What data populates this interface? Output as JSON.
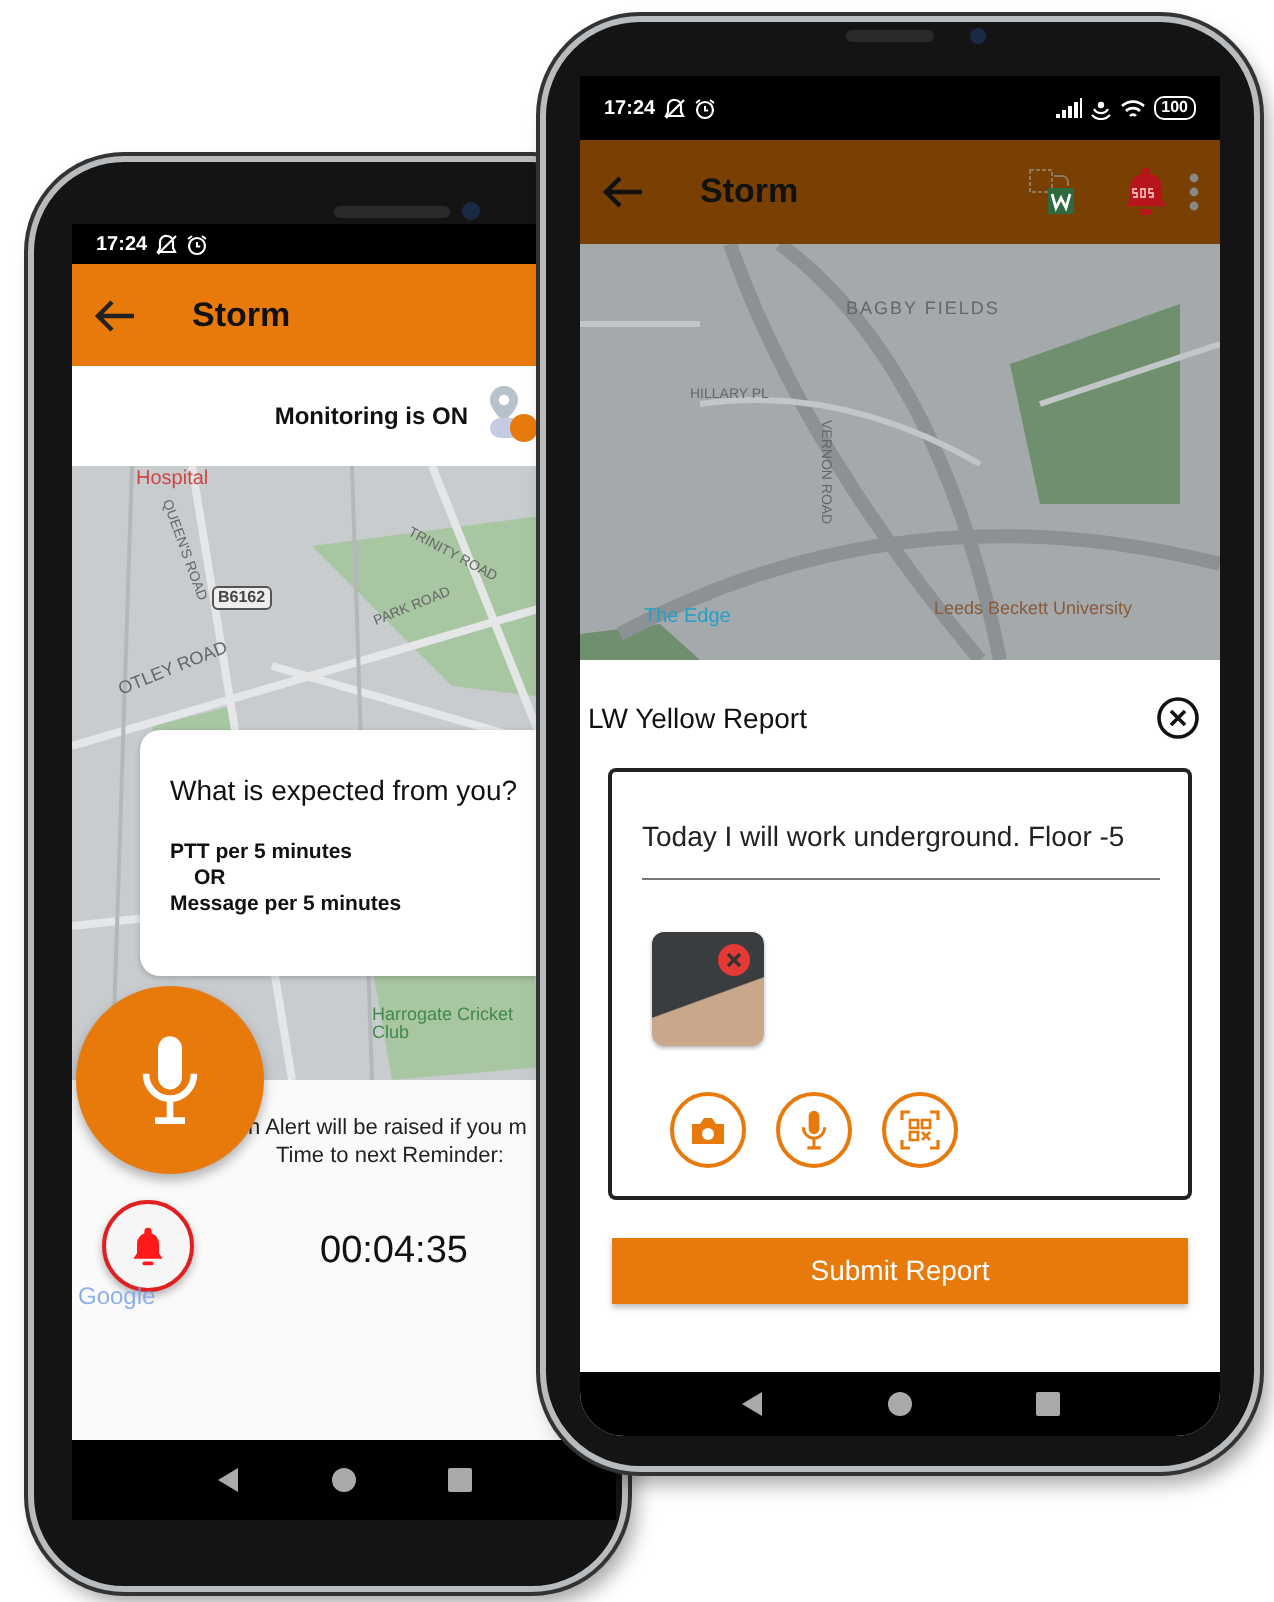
{
  "left_phone": {
    "status_bar": {
      "time": "17:24"
    },
    "app_bar": {
      "title": "Storm"
    },
    "monitoring": {
      "label": "Monitoring is ON",
      "on": true
    },
    "map": {
      "labels": [
        {
          "text": "Hospital",
          "kind": "poi"
        },
        {
          "text": "QUEEN'S ROAD",
          "kind": "road"
        },
        {
          "text": "B6162",
          "kind": "route"
        },
        {
          "text": "OTLEY ROAD",
          "kind": "road"
        },
        {
          "text": "TRINITY ROAD",
          "kind": "road"
        },
        {
          "text": "PARK ROAD",
          "kind": "road"
        },
        {
          "text": "Harrogate Cricket Club",
          "kind": "park"
        }
      ]
    },
    "expectation_card": {
      "title": "What is expected from you?",
      "lines": [
        "PTT per 5 minutes",
        "OR",
        "Message per 5 minutes"
      ]
    },
    "alert_text": "n Alert will be raised if you m",
    "reminder_label": "Time to next Reminder:",
    "timer": "00:04:35",
    "map_attribution": "Google"
  },
  "right_phone": {
    "status_bar": {
      "time": "17:24",
      "battery": "100"
    },
    "app_bar": {
      "title": "Storm"
    },
    "map": {
      "labels": [
        {
          "text": "BAGBY FIELDS",
          "kind": "area"
        },
        {
          "text": "HILLARY PL",
          "kind": "road"
        },
        {
          "text": "VERNON ROAD",
          "kind": "road"
        },
        {
          "text": "The Edge",
          "kind": "transit"
        },
        {
          "text": "Leeds Beckett University",
          "kind": "school"
        }
      ]
    },
    "report_sheet": {
      "title": "LW Yellow Report",
      "report_text": "Today I will work underground. Floor -5",
      "submit_button": "Submit Report"
    }
  }
}
